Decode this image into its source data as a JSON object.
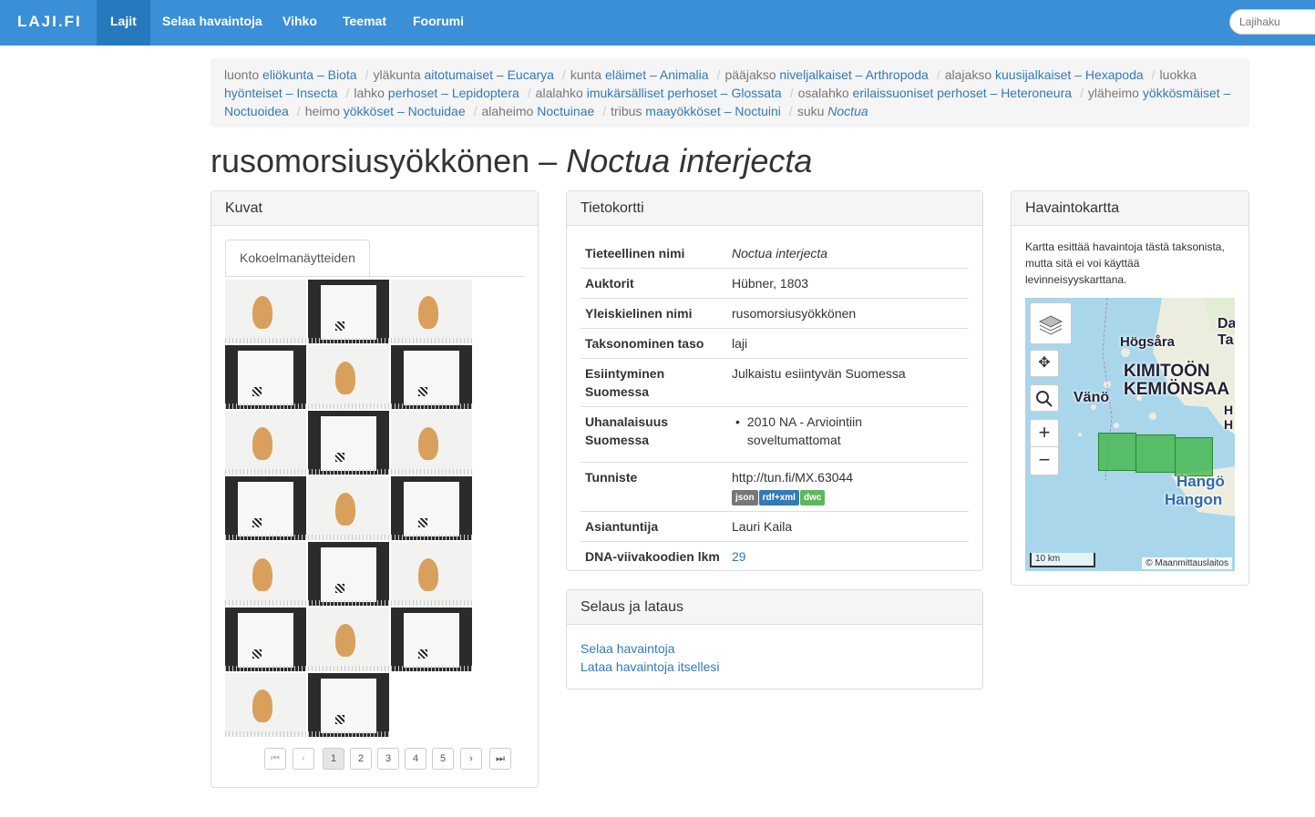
{
  "nav": {
    "brand": "LAJI.FI",
    "items": [
      {
        "label": "Lajit",
        "active": true
      },
      {
        "label": "Selaa havaintoja"
      },
      {
        "label": "Vihko"
      },
      {
        "label": "Teemat"
      },
      {
        "label": "Foorumi"
      }
    ],
    "search_placeholder": "Lajihaku"
  },
  "breadcrumb": [
    {
      "rank": "luonto",
      "name": "eliökunta – Biota"
    },
    {
      "rank": "yläkunta",
      "name": "aitotumaiset – Eucarya"
    },
    {
      "rank": "kunta",
      "name": "eläimet – Animalia"
    },
    {
      "rank": "pääjakso",
      "name": "niveljalkaiset – Arthropoda"
    },
    {
      "rank": "alajakso",
      "name": "kuusijalkaiset – Hexapoda"
    },
    {
      "rank": "luokka",
      "name": "hyönteiset – Insecta"
    },
    {
      "rank": "lahko",
      "name": "perhoset – Lepidoptera"
    },
    {
      "rank": "alalahko",
      "name": "imukärsälliset perhoset – Glossata"
    },
    {
      "rank": "osalahko",
      "name": "erilaissuoniset perhoset – Heteroneura"
    },
    {
      "rank": "yläheimo",
      "name": "yökkösmäiset – Noctuoidea"
    },
    {
      "rank": "heimo",
      "name": "yökköset – Noctuidae"
    },
    {
      "rank": "alaheimo",
      "name": "Noctuinae"
    },
    {
      "rank": "tribus",
      "name": "maayökköset – Noctuini"
    },
    {
      "rank": "suku",
      "name": "Noctua"
    }
  ],
  "title": {
    "vernacular": "rusomorsiusyökkönen",
    "separator": "–",
    "scientific": "Noctua interjecta"
  },
  "kuvat": {
    "heading": "Kuvat",
    "tab": "Kokoelmanäytteiden",
    "pager": [
      "1",
      "2",
      "3",
      "4",
      "5"
    ],
    "thumbnails": [
      "light",
      "dark",
      "light",
      "dark",
      "light",
      "dark",
      "light",
      "dark",
      "light",
      "dark",
      "light",
      "dark",
      "light",
      "dark",
      "light",
      "dark",
      "light",
      "dark",
      "light",
      "dark"
    ]
  },
  "tietokortti": {
    "heading": "Tietokortti",
    "rows": {
      "scientific_name": {
        "key": "Tieteellinen nimi",
        "value": "Noctua interjecta"
      },
      "authors": {
        "key": "Auktorit",
        "value": "Hübner, 1803"
      },
      "common_name": {
        "key": "Yleiskielinen nimi",
        "value": "rusomorsiusyökkönen"
      },
      "rank": {
        "key": "Taksonominen taso",
        "value": "laji"
      },
      "occurrence": {
        "key": "Esiintyminen Suomessa",
        "value": "Julkaistu esiintyvän Suomessa"
      },
      "threat": {
        "key": "Uhanalaisuus Suomessa",
        "value": "2010 NA - Arviointiin soveltumattomat"
      },
      "identifier": {
        "key": "Tunniste",
        "value": "http://tun.fi/MX.63044",
        "badges": [
          "json",
          "rdf+xml",
          "dwc"
        ]
      },
      "expert": {
        "key": "Asiantuntija",
        "value": "Lauri Kaila"
      },
      "dna": {
        "key": "DNA-viivakoodien lkm",
        "value": "29"
      }
    }
  },
  "selaus": {
    "heading": "Selaus ja lataus",
    "links": [
      "Selaa havaintoja",
      "Lataa havaintoja itsellesi"
    ]
  },
  "havaintokartta": {
    "heading": "Havaintokartta",
    "description": "Kartta esittää havaintoja tästä taksonista, mutta sitä ei voi käyttää levinneisyyskarttana.",
    "labels": [
      "Högsåra",
      "KIMITOÖN",
      "KEMIÖNSAA",
      "Vänö",
      "Hangö",
      "Hangon",
      "Da",
      "Ta",
      "H",
      "H"
    ],
    "scale": "10 km",
    "attribution": "© Maanmittauslaitos"
  }
}
